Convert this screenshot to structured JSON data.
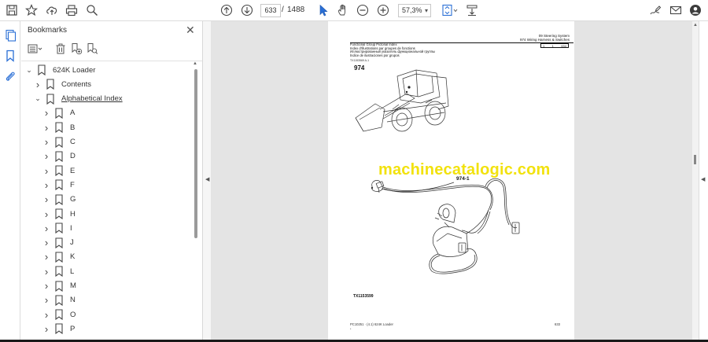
{
  "toolbar": {
    "page_current": "633",
    "page_separator": "/",
    "page_total": "1488",
    "zoom": "57,3%",
    "icons": [
      "save-icon",
      "bookmark-star-icon",
      "upload-icon",
      "print-icon",
      "zoom-search-icon",
      "page-up-icon",
      "page-down-icon",
      "select-cursor-icon",
      "hand-icon",
      "zoom-out-icon",
      "zoom-in-icon",
      "fit-page-icon",
      "scroll-mode-icon",
      "sign-icon",
      "mail-icon",
      "account-icon"
    ]
  },
  "bookmarks": {
    "header": "Bookmarks",
    "close_label": "✕",
    "tree": [
      {
        "label": "624K Loader",
        "level": 0,
        "expanded": true,
        "underline": false
      },
      {
        "label": "Contents",
        "level": 1,
        "expanded": false,
        "underline": false
      },
      {
        "label": "Alphabetical Index",
        "level": 1,
        "expanded": true,
        "underline": true
      },
      {
        "label": "A",
        "level": 2,
        "expanded": false,
        "underline": false
      },
      {
        "label": "B",
        "level": 2,
        "expanded": false,
        "underline": false
      },
      {
        "label": "C",
        "level": 2,
        "expanded": false,
        "underline": false
      },
      {
        "label": "D",
        "level": 2,
        "expanded": false,
        "underline": false
      },
      {
        "label": "E",
        "level": 2,
        "expanded": false,
        "underline": false
      },
      {
        "label": "F",
        "level": 2,
        "expanded": false,
        "underline": false
      },
      {
        "label": "G",
        "level": 2,
        "expanded": false,
        "underline": false
      },
      {
        "label": "H",
        "level": 2,
        "expanded": false,
        "underline": false
      },
      {
        "label": "I",
        "level": 2,
        "expanded": false,
        "underline": false
      },
      {
        "label": "J",
        "level": 2,
        "expanded": false,
        "underline": false
      },
      {
        "label": "K",
        "level": 2,
        "expanded": false,
        "underline": false
      },
      {
        "label": "L",
        "level": 2,
        "expanded": false,
        "underline": false
      },
      {
        "label": "M",
        "level": 2,
        "expanded": false,
        "underline": false
      },
      {
        "label": "N",
        "level": 2,
        "expanded": false,
        "underline": false
      },
      {
        "label": "O",
        "level": 2,
        "expanded": false,
        "underline": false
      },
      {
        "label": "P",
        "level": 2,
        "expanded": false,
        "underline": false
      }
    ]
  },
  "page": {
    "header_right_line1": "09 Steering System",
    "header_right_line2": "974 Wiring Harness & Switches",
    "page_box_left": "1",
    "page_box_mid": "1",
    "page_box_right": "634",
    "header_left_line1": "Functional Group Pictorial Index",
    "header_left_line2": "Index d'illustrations par groupes de fonctions",
    "header_left_line3": "Иллюстрированный указатель функциональной группы",
    "header_left_line4": "Índice de ilustraciones por grupos",
    "ref_code": "TX1153569 A-1",
    "group_number": "974",
    "callout": "974-1",
    "figure_id": "TX1153599",
    "footer_left": "PC10251 · (4.1)    624K Loader",
    "footer_right": "633",
    "footer_mark": "*",
    "watermark": "machinecatalogic.com"
  },
  "colors": {
    "accent_blue": "#2a6fd6",
    "watermark_yellow": "#f2e20e",
    "doc_background": "#e4e4e4"
  }
}
